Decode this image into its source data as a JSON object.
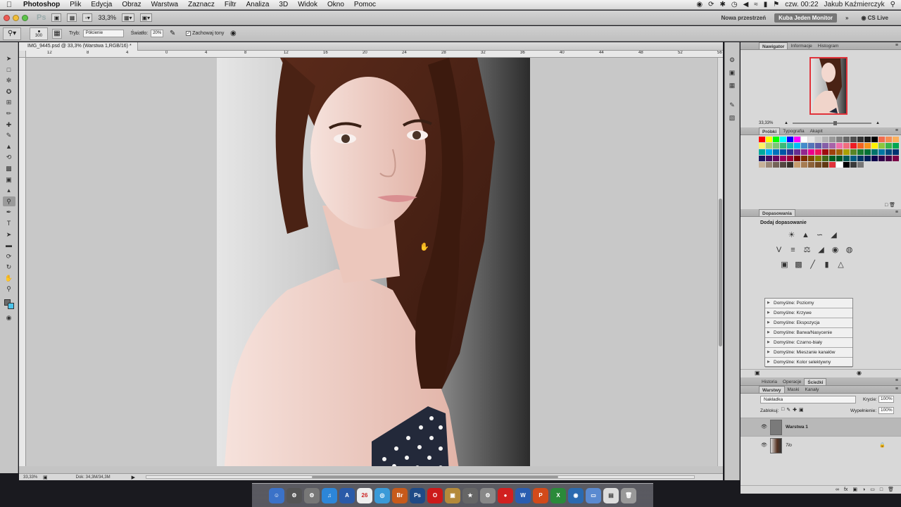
{
  "menubar": {
    "app": "Photoshop",
    "menus": [
      "Plik",
      "Edycja",
      "Obraz",
      "Warstwa",
      "Zaznacz",
      "Filtr",
      "Analiza",
      "3D",
      "Widok",
      "Okno",
      "Pomoc"
    ],
    "clock": "czw. 00:22",
    "user": "Jakub Kaźmierczyk"
  },
  "appbar": {
    "logo": "Ps",
    "zoom": "33,3%",
    "workspace_new": "Nowa przestrzeń",
    "workspace_active": "Kuba Jeden Monitor",
    "cs_live": "CS Live"
  },
  "options": {
    "brush_size": "300",
    "mode_label": "Tryb:",
    "mode_value": "Półcienie",
    "light_label": "Światło:",
    "light_value": "20%",
    "protect_label": "Zachowaj tony"
  },
  "document": {
    "tab_title": "IMG_9445.psd @ 33,3% (Warstwa 1,RGB/16) *",
    "ruler_ticks": [
      "12",
      "8",
      "4",
      "0",
      "4",
      "8",
      "12",
      "16",
      "20",
      "24",
      "28",
      "32",
      "36",
      "40",
      "44",
      "48",
      "52",
      "56"
    ],
    "status_zoom": "33,33%",
    "status_info": "Dok: 34,3M/34,3M"
  },
  "panels": {
    "nav_tabs": [
      "Nawigator",
      "Informacje",
      "Histogram"
    ],
    "nav_zoom": "33,33%",
    "swatch_tabs": [
      "Próbki",
      "Typografia",
      "Akapit"
    ],
    "adj_tab": "Dopasowania",
    "adj_title": "Dodaj dopasowanie",
    "presets": [
      "Domyślne: Poziomy",
      "Domyślne: Krzywe",
      "Domyślne: Ekspozycja",
      "Domyślne: Barwa/Nasycenie",
      "Domyślne: Czarno-biały",
      "Domyślne: Mieszanie kanałów",
      "Domyślne: Kolor selektywny"
    ],
    "hist_tabs": [
      "Historia",
      "Operacje",
      "Ścieżki"
    ],
    "layer_tabs": [
      "Warstwy",
      "Maski",
      "Kanały"
    ],
    "blend_mode": "Nakładka",
    "opacity_label": "Krycie:",
    "opacity_value": "100%",
    "lock_label": "Zablokuj:",
    "fill_label": "Wypełnienie:",
    "fill_value": "100%",
    "layers": [
      {
        "name": "Warstwa 1",
        "selected": true
      },
      {
        "name": "Tło",
        "selected": false
      }
    ]
  },
  "colors": {
    "foreground": "#6b6b6b",
    "background": "#4cc3ea",
    "accent": "#e0333b"
  }
}
